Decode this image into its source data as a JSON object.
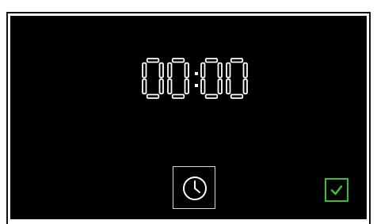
{
  "display": {
    "time": "00:00"
  },
  "controls": {
    "time_icon": "clock-icon",
    "confirm_icon": "checkmark-icon"
  },
  "colors": {
    "background": "#000000",
    "segment": "#ffffff",
    "accent": "#37c22f"
  }
}
